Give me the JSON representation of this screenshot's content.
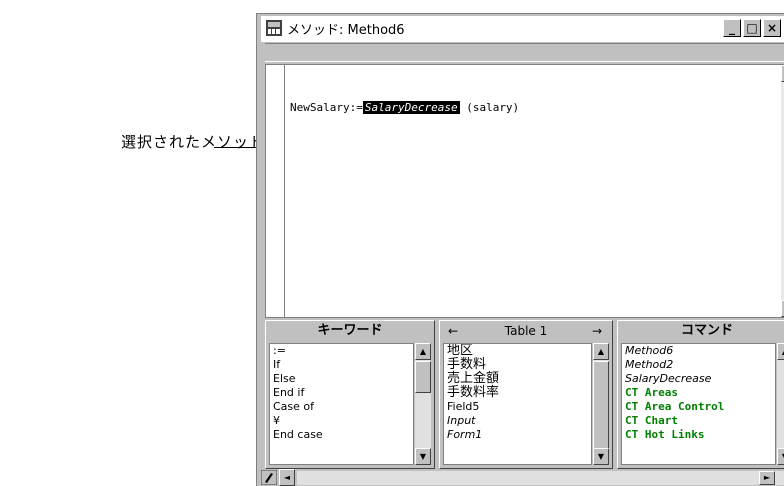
{
  "callout": {
    "label": "選択されたメソッド"
  },
  "window": {
    "title": "メソッド: Method6",
    "minimize": "_",
    "maximize": "□",
    "close": "×"
  },
  "editor": {
    "prefix": "NewSalary:=",
    "selected_method": "SalaryDecrease",
    "suffix": " (salary)"
  },
  "panels": {
    "keywords": {
      "title": "キーワード",
      "items": [
        ":=",
        "If",
        "Else",
        "End if",
        "Case of",
        "¥",
        "End case"
      ]
    },
    "tables": {
      "title": "Table 1",
      "left_arrow": "←",
      "right_arrow": "→",
      "items": [
        "地区",
        "手数料",
        "売上金額",
        "手数料率",
        "Field5",
        "Input",
        "Form1"
      ]
    },
    "commands": {
      "title": "コマンド",
      "items": [
        "Method6",
        "Method2",
        "SalaryDecrease",
        "CT Areas",
        "CT Area Control",
        "CT Chart",
        "CT Hot Links"
      ]
    }
  },
  "scroll": {
    "up": "▲",
    "down": "▼",
    "left": "◄",
    "right": "►"
  }
}
